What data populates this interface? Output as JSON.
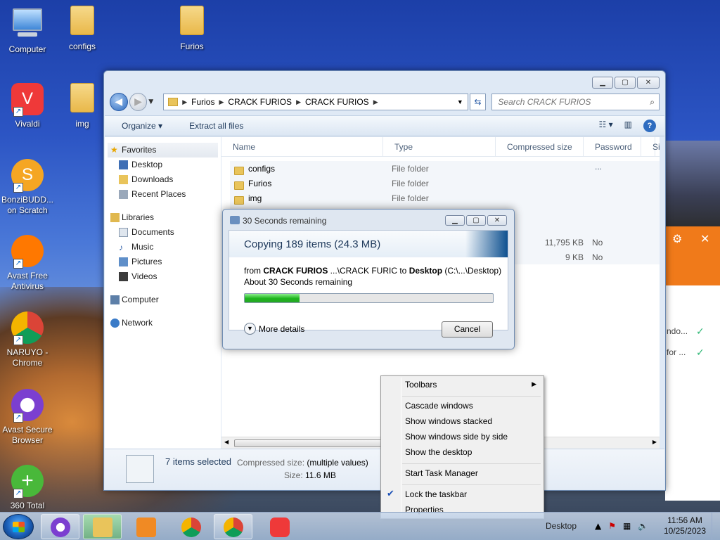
{
  "desktop": {
    "icons": [
      {
        "label": "Computer"
      },
      {
        "label": "configs"
      },
      {
        "label": "Furios"
      },
      {
        "label": "Vivaldi"
      },
      {
        "label": "img"
      },
      {
        "label": "BonziBUDD... on Scratch"
      },
      {
        "label": "Avast Free Antivirus"
      },
      {
        "label": "NARUYO - Chrome"
      },
      {
        "label": "Avast Secure Browser"
      },
      {
        "label": "360 Total"
      }
    ]
  },
  "explorer": {
    "breadcrumb": [
      "Furios",
      "CRACK FURIOS",
      "CRACK FURIOS"
    ],
    "search_placeholder": "Search CRACK FURIOS",
    "toolbar": {
      "organize": "Organize ▾",
      "extract": "Extract all files"
    },
    "nav": {
      "favorites": "Favorites",
      "fav_items": [
        "Desktop",
        "Downloads",
        "Recent Places"
      ],
      "libraries": "Libraries",
      "lib_items": [
        "Documents",
        "Music",
        "Pictures",
        "Videos"
      ],
      "computer": "Computer",
      "network": "Network"
    },
    "columns": [
      "Name",
      "Type",
      "Compressed size",
      "Password ...",
      "Si"
    ],
    "files": [
      {
        "name": "configs",
        "type": "File folder",
        "size": "",
        "password": ""
      },
      {
        "name": "Furios",
        "type": "File folder",
        "size": "",
        "password": ""
      },
      {
        "name": "img",
        "type": "File folder",
        "size": "",
        "password": ""
      },
      {
        "name": "",
        "type": "",
        "size": "11,795 KB",
        "password": "No"
      },
      {
        "name": "",
        "type": "",
        "size": "9 KB",
        "password": "No"
      }
    ],
    "details": {
      "selected": "7 items selected",
      "compressed_label": "Compressed size:",
      "compressed_value": "(multiple values)",
      "size_label": "Size:",
      "size_value": "11.6 MB"
    }
  },
  "copy_dialog": {
    "title": "30 Seconds remaining",
    "heading": "Copying 189 items (24.3 MB)",
    "from_prefix": "from ",
    "from_src": "CRACK FURIOS",
    "from_path": " ...\\CRACK FURIC",
    "to_word": " to ",
    "to_dest": "Desktop",
    "to_path": " (C:\\...\\Desktop)",
    "remaining": "About 30 Seconds remaining",
    "progress": 0.22,
    "more": "More details",
    "cancel": "Cancel"
  },
  "avast_panel": {
    "row1": "ndo...",
    "row2": "for ..."
  },
  "context_menu": {
    "items": [
      "Toolbars",
      "Cascade windows",
      "Show windows stacked",
      "Show windows side by side",
      "Show the desktop",
      "Start Task Manager",
      "Lock the taskbar",
      "Properties"
    ]
  },
  "taskbar": {
    "desktop_label": "Desktop",
    "time": "11:56 AM",
    "date": "10/25/2023"
  }
}
